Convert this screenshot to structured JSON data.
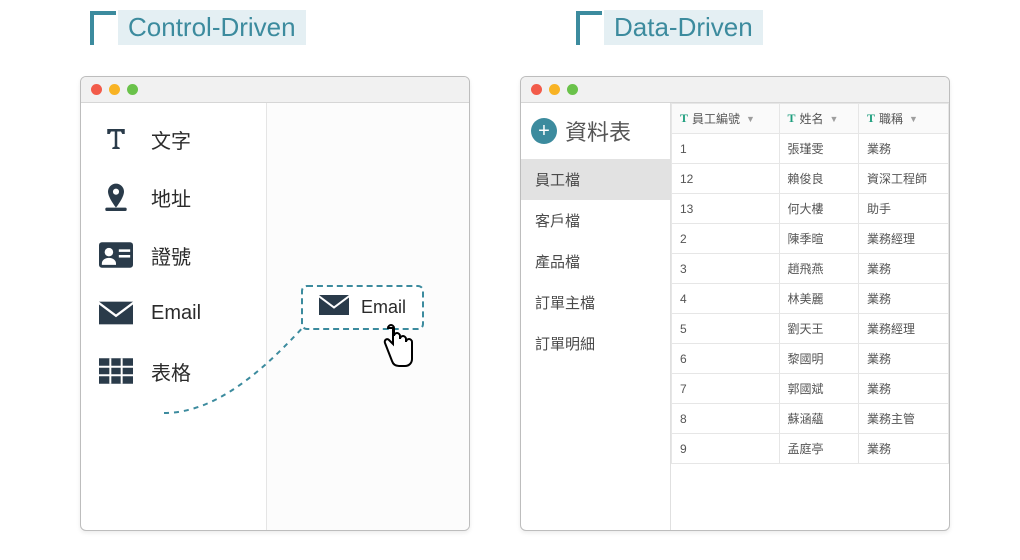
{
  "labels": {
    "left": "Control-Driven",
    "right": "Data-Driven"
  },
  "left_window": {
    "tools": [
      {
        "id": "text",
        "label": "文字"
      },
      {
        "id": "address",
        "label": "地址"
      },
      {
        "id": "idno",
        "label": "證號"
      },
      {
        "id": "email",
        "label": "Email"
      },
      {
        "id": "table",
        "label": "表格"
      }
    ],
    "dropped": {
      "icon": "email",
      "label": "Email"
    }
  },
  "right_window": {
    "datasource_title": "資料表",
    "tables": [
      "員工檔",
      "客戶檔",
      "產品檔",
      "訂單主檔",
      "訂單明細"
    ],
    "selected_table_index": 0,
    "columns": [
      "員工編號",
      "姓名",
      "職稱"
    ],
    "rows": [
      [
        "1",
        "張瑾雯",
        "業務"
      ],
      [
        "12",
        "賴俊良",
        "資深工程師"
      ],
      [
        "13",
        "何大樓",
        "助手"
      ],
      [
        "2",
        "陳季暄",
        "業務經理"
      ],
      [
        "3",
        "趙飛燕",
        "業務"
      ],
      [
        "4",
        "林美麗",
        "業務"
      ],
      [
        "5",
        "劉天王",
        "業務經理"
      ],
      [
        "6",
        "黎國明",
        "業務"
      ],
      [
        "7",
        "郭國斌",
        "業務"
      ],
      [
        "8",
        "蘇涵蘊",
        "業務主管"
      ],
      [
        "9",
        "孟庭亭",
        "業務"
      ]
    ]
  }
}
